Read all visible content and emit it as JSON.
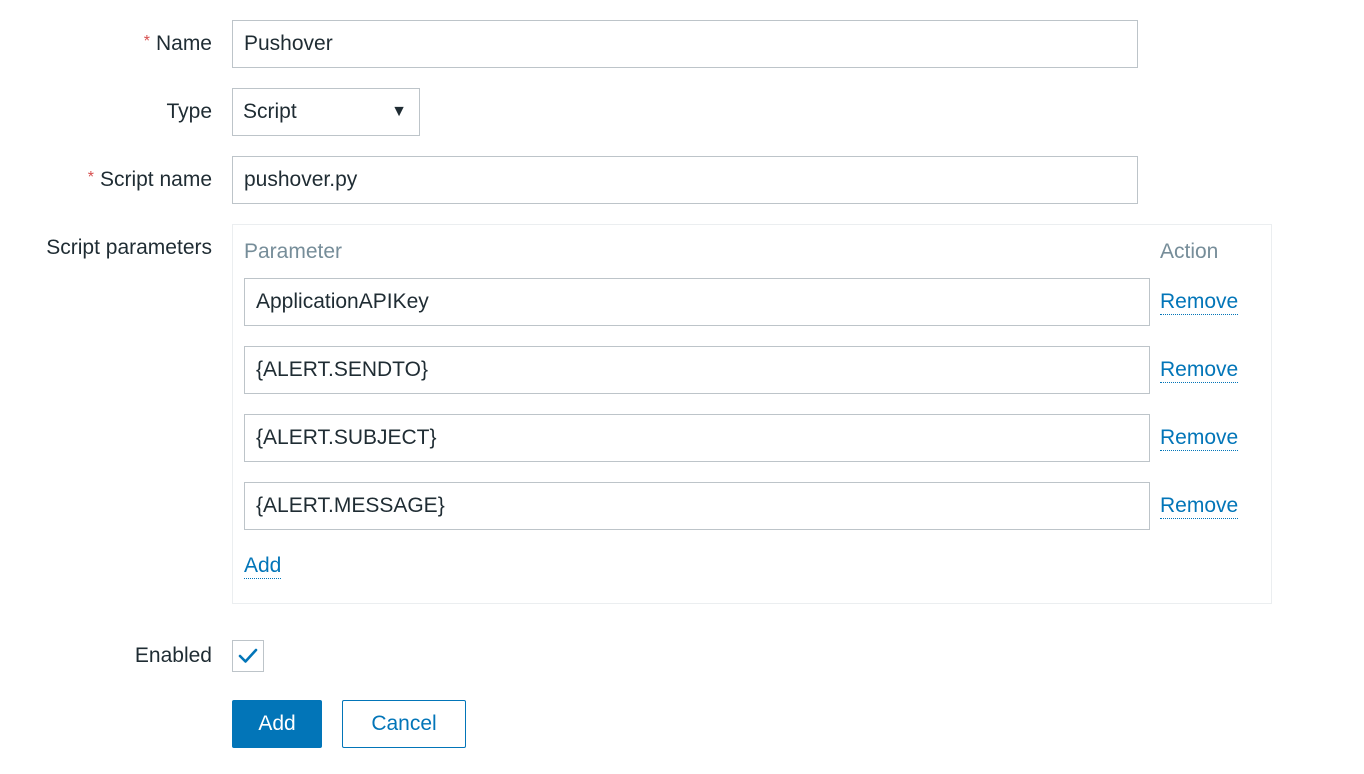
{
  "form": {
    "name": {
      "required_mark": "*",
      "label": "Name",
      "value": "Pushover"
    },
    "type": {
      "label": "Type",
      "value": "Script",
      "arrow_icon": "triangle-down-icon"
    },
    "script_name": {
      "required_mark": "*",
      "label": "Script name",
      "value": "pushover.py"
    },
    "script_parameters": {
      "label": "Script parameters",
      "col_parameter": "Parameter",
      "col_action": "Action",
      "rows": [
        {
          "value": "ApplicationAPIKey",
          "action": "Remove"
        },
        {
          "value": "{ALERT.SENDTO}",
          "action": "Remove"
        },
        {
          "value": "{ALERT.SUBJECT}",
          "action": "Remove"
        },
        {
          "value": "{ALERT.MESSAGE}",
          "action": "Remove"
        }
      ],
      "add_link": "Add"
    },
    "enabled": {
      "label": "Enabled",
      "checked": true,
      "check_color": "#0275b8"
    }
  },
  "buttons": {
    "add": "Add",
    "cancel": "Cancel"
  },
  "colors": {
    "primary": "#0275b8",
    "required": "#d64e4e",
    "border": "#bdc4c9",
    "muted_header": "#768d99"
  }
}
